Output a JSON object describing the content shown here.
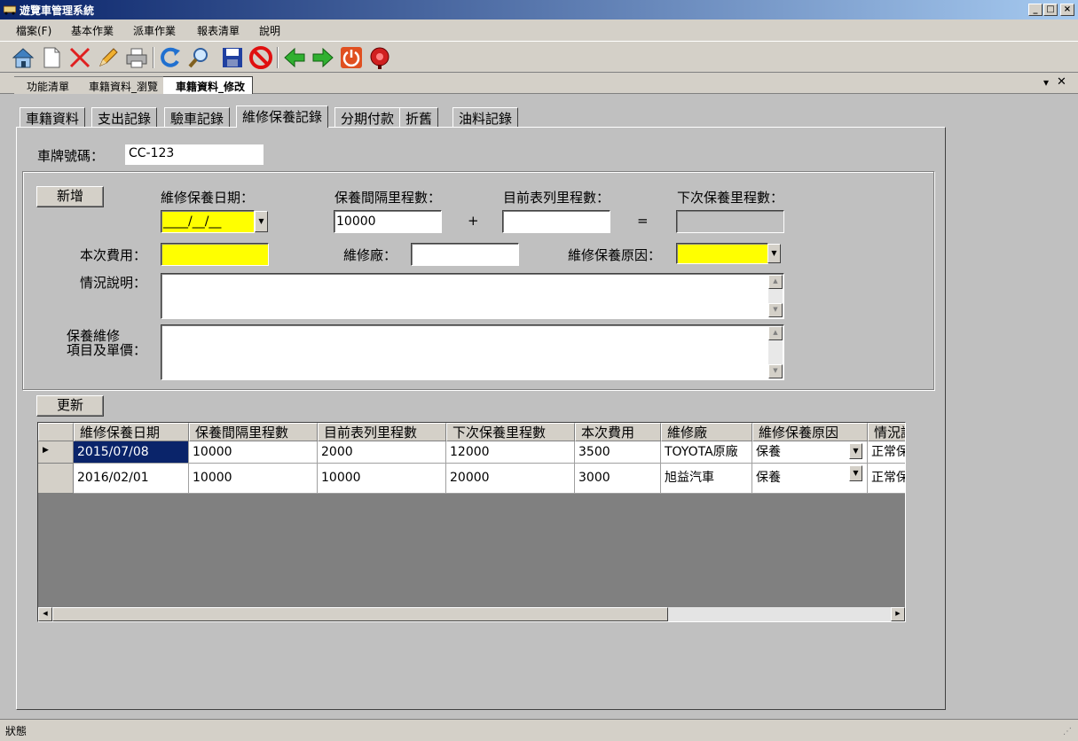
{
  "window": {
    "title": "遊覽車管理系統"
  },
  "menu": {
    "items": [
      "檔案(F)",
      "基本作業",
      "派車作業",
      "報表清單",
      "說明"
    ]
  },
  "doc_tabs": [
    "功能清單",
    "車籍資料_瀏覽",
    "車籍資料_修改"
  ],
  "inner_tabs": [
    "車籍資料",
    "支出記錄",
    "驗車記錄",
    "維修保養記錄",
    "分期付款",
    "折舊",
    "油料記錄"
  ],
  "form": {
    "plate_label": "車牌號碼：",
    "plate_value": "CC-123",
    "add_button": "新增",
    "update_button": "更新",
    "date_label": "維修保養日期：",
    "date_value": "____/__/__",
    "interval_label": "保養間隔里程數：",
    "interval_value": "10000",
    "plus": "+",
    "current_label": "目前表列里程數：",
    "current_value": "",
    "equals": "=",
    "next_label": "下次保養里程數：",
    "next_value": "",
    "cost_label": "本次費用：",
    "cost_value": "",
    "shop_label": "維修廠：",
    "shop_value": "",
    "reason_label": "維修保養原因：",
    "reason_value": "",
    "situation_label": "情況說明：",
    "items_label_1": "保養維修",
    "items_label_2": "項目及單價："
  },
  "grid": {
    "columns": [
      "維修保養日期",
      "保養間隔里程數",
      "目前表列里程數",
      "下次保養里程數",
      "本次費用",
      "維修廠",
      "維修保養原因",
      "情況說"
    ],
    "rows": [
      [
        "2015/07/08",
        "10000",
        "2000",
        "12000",
        "3500",
        "TOYOTA原廠",
        "保養",
        "正常保"
      ],
      [
        "2016/02/01",
        "10000",
        "10000",
        "20000",
        "3000",
        "旭益汽車",
        "保養",
        "正常保"
      ]
    ]
  },
  "status": {
    "text": "狀態"
  },
  "colors": {
    "title_bar": "#0a246a",
    "highlight_yellow": "#ffff00",
    "selection": "#0a246a"
  }
}
